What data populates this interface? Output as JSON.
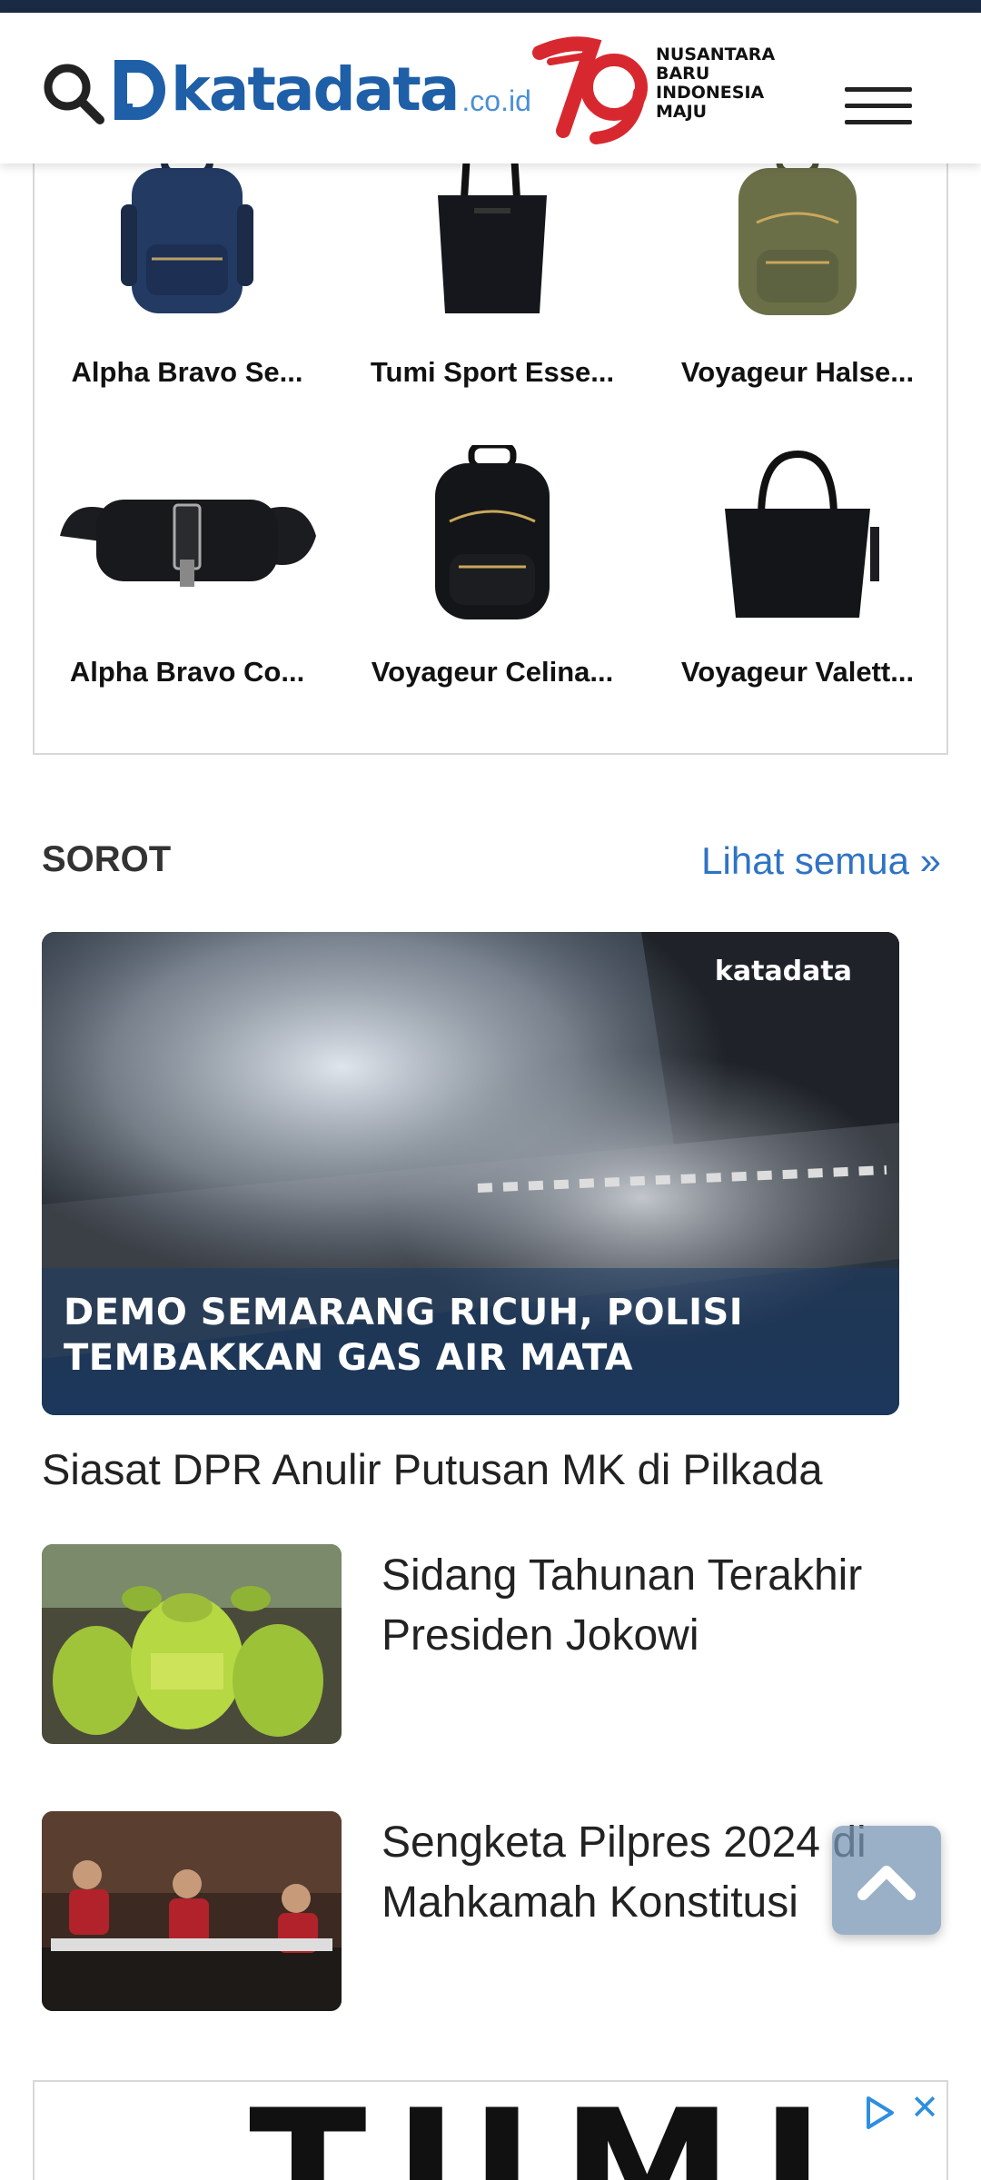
{
  "header": {
    "logo_word": "katadata",
    "logo_tld": ".co.id",
    "anniversary_lines": [
      "NUSANTARA",
      "BARU",
      "INDONESIA",
      "MAJU"
    ],
    "anniversary_number": "79",
    "search_icon": "search-icon",
    "menu_icon": "hamburger-menu-icon"
  },
  "products": [
    {
      "label": "Alpha Bravo Se...",
      "icon": "navy-backpack"
    },
    {
      "label": "Tumi Sport Esse...",
      "icon": "black-tote-bag"
    },
    {
      "label": "Voyageur Halse...",
      "icon": "olive-backpack"
    },
    {
      "label": "Alpha Bravo Co...",
      "icon": "black-sling-bag"
    },
    {
      "label": "Voyageur Celina...",
      "icon": "black-backpack"
    },
    {
      "label": "Voyageur Valett...",
      "icon": "black-handbag"
    }
  ],
  "section": {
    "title": "SOROT",
    "see_all": "Lihat semua »"
  },
  "hero": {
    "caption_line1": "DEMO SEMARANG RICUH, POLISI",
    "caption_line2": "TEMBAKKAN GAS AIR MATA",
    "watermark": "katadata",
    "title": "Siasat DPR Anulir Putusan MK di Pilkada"
  },
  "list": [
    {
      "title": "Sidang Tahunan Terakhir Presiden Jokowi",
      "thumb": "lpg-gas-cylinders"
    },
    {
      "title": "Sengketa Pilpres 2024 di Mahkamah Konstitusi",
      "thumb": "court-judges"
    }
  ],
  "ad": {
    "brand": "TUMI",
    "choice_icon": "adchoices-icon",
    "close_icon": "close-icon"
  },
  "colors": {
    "brand_blue": "#1f5fa7",
    "link_blue": "#2f73c4",
    "anniversary_red": "#d8282f",
    "topbar": "#1a2a44"
  }
}
